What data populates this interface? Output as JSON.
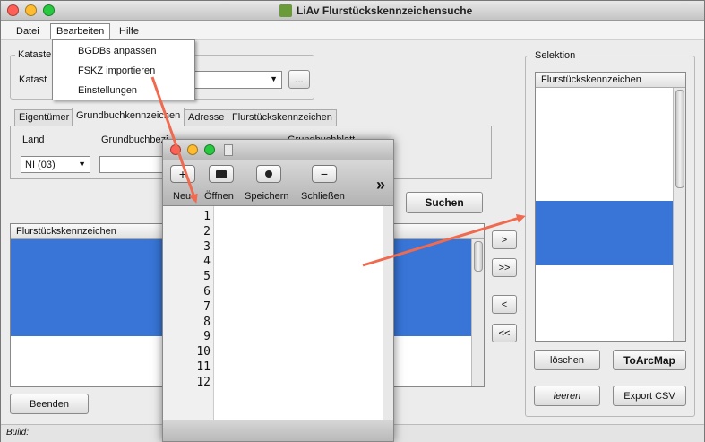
{
  "window": {
    "title": "LiAv Flurstückskennzeichensuche"
  },
  "menu": {
    "items": [
      "Datei",
      "Bearbeiten",
      "Hilfe"
    ]
  },
  "dropdown": {
    "items": [
      "BGDBs anpassen",
      "FSKZ importieren",
      "Einstellungen"
    ]
  },
  "kataster": {
    "group_label": "Kataste",
    "row_label": "Katast",
    "combo_value": "",
    "browse_label": "..."
  },
  "tabs": [
    "Eigentümer",
    "Grundbuchkennzeichen",
    "Adresse",
    "Flurstückskennzeichen"
  ],
  "grundbuch": {
    "land_label": "Land",
    "land_value": "NI (03)",
    "bezirk_label": "Grundbuchbezi",
    "blatt_label": "Grundbuchblatt",
    "bezirk_value": ""
  },
  "search_button": "Suchen",
  "results": {
    "header": "Flurstückskennzeichen",
    "rows": [
      "",
      "",
      "",
      "",
      "",
      "",
      "",
      "",
      ""
    ]
  },
  "move_buttons": [
    ">",
    ">>",
    "<",
    "<<"
  ],
  "selection": {
    "group_label": "Selektion",
    "header": "Flurstückskennzeichen",
    "rows": [
      "",
      "",
      "",
      "",
      "",
      "",
      "",
      "",
      "",
      "",
      "",
      "",
      "",
      "",
      ""
    ]
  },
  "actions": {
    "delete": "löschen",
    "to_arcmap": "ToArcMap",
    "clear": "leeren",
    "export": "Export CSV"
  },
  "close_button": "Beenden",
  "status": {
    "build_label": "Build:"
  },
  "editor": {
    "title": "",
    "toolbar": {
      "new": "Neu",
      "open": "Öffnen",
      "save": "Speichern",
      "close": "Schließen",
      "more": "»"
    },
    "line_numbers": [
      "1",
      "2",
      "3",
      "4",
      "5",
      "6",
      "7",
      "8",
      "9",
      "10",
      "11",
      "12"
    ],
    "lines": [
      "",
      "",
      "",
      "",
      "",
      "",
      "",
      "",
      "",
      "",
      "",
      ""
    ],
    "status": ""
  },
  "colors": {
    "selection": "#3875d7",
    "arrow": "#ef6a4e",
    "close": "#ff5f57",
    "minimize": "#febc2e",
    "zoom": "#28c840"
  }
}
